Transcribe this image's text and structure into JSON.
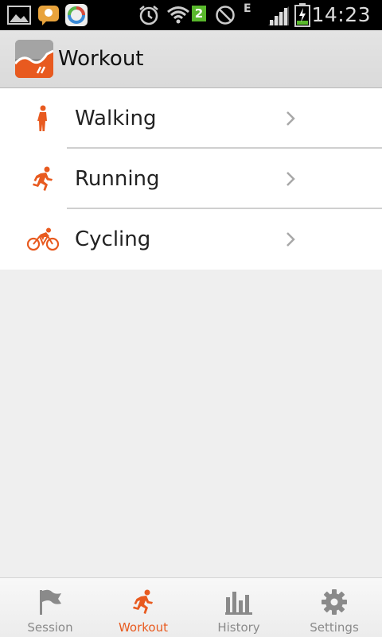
{
  "status_bar": {
    "time": "14:23",
    "sim_badge": "2",
    "network_type": "E"
  },
  "action_bar": {
    "title": "Workout"
  },
  "workouts": [
    {
      "label": "Walking",
      "icon": "walking-icon"
    },
    {
      "label": "Running",
      "icon": "running-icon"
    },
    {
      "label": "Cycling",
      "icon": "cycling-icon"
    }
  ],
  "bottom_nav": {
    "tabs": [
      {
        "label": "Session",
        "icon": "flag-icon",
        "active": false
      },
      {
        "label": "Workout",
        "icon": "running-icon",
        "active": true
      },
      {
        "label": "History",
        "icon": "bar-chart-icon",
        "active": false
      },
      {
        "label": "Settings",
        "icon": "gear-icon",
        "active": false
      }
    ]
  },
  "colors": {
    "accent": "#e85a1f",
    "inactive": "#8a8a8a"
  }
}
